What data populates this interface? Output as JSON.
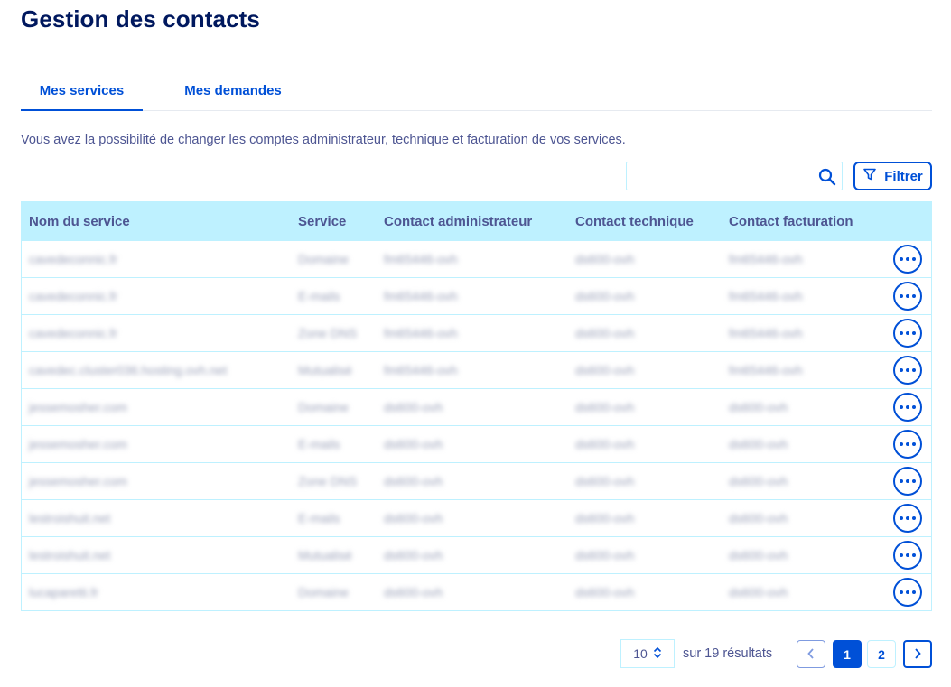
{
  "page": {
    "title": "Gestion des contacts",
    "intro": "Vous avez la possibilité de changer les comptes administrateur, technique et facturation de vos services."
  },
  "tabs": [
    {
      "label": "Mes services",
      "active": true
    },
    {
      "label": "Mes demandes",
      "active": false
    }
  ],
  "toolbar": {
    "search_placeholder": "",
    "filter_label": "Filtrer"
  },
  "table": {
    "headers": [
      "Nom du service",
      "Service",
      "Contact administrateur",
      "Contact technique",
      "Contact facturation"
    ],
    "rows": [
      [
        "cavedeconnic.fr",
        "Domaine",
        "fm65446-ovh",
        "ds600-ovh",
        "fm65446-ovh"
      ],
      [
        "cavedeconnic.fr",
        "E-mails",
        "fm65446-ovh",
        "ds600-ovh",
        "fm65446-ovh"
      ],
      [
        "cavedeconnic.fr",
        "Zone DNS",
        "fm65446-ovh",
        "ds600-ovh",
        "fm65446-ovh"
      ],
      [
        "cavedec.cluster036.hosting.ovh.net",
        "Mutualisé",
        "fm65446-ovh",
        "ds600-ovh",
        "fm65446-ovh"
      ],
      [
        "jessemosher.com",
        "Domaine",
        "ds600-ovh",
        "ds600-ovh",
        "ds600-ovh"
      ],
      [
        "jessemosher.com",
        "E-mails",
        "ds600-ovh",
        "ds600-ovh",
        "ds600-ovh"
      ],
      [
        "jessemosher.com",
        "Zone DNS",
        "ds600-ovh",
        "ds600-ovh",
        "ds600-ovh"
      ],
      [
        "lestroishuit.net",
        "E-mails",
        "ds600-ovh",
        "ds600-ovh",
        "ds600-ovh"
      ],
      [
        "lestroishuit.net",
        "Mutualisé",
        "ds600-ovh",
        "ds600-ovh",
        "ds600-ovh"
      ],
      [
        "lucaparetti.fr",
        "Domaine",
        "ds600-ovh",
        "ds600-ovh",
        "ds600-ovh"
      ]
    ]
  },
  "pagination": {
    "per_page": "10",
    "results_text": "sur 19 résultats",
    "pages": [
      "1",
      "2"
    ],
    "current_page": "1"
  },
  "icons": {
    "search": "search-icon",
    "filter": "filter-icon",
    "more": "more-options-icon",
    "prev": "chevron-left-icon",
    "next": "chevron-right-icon",
    "sort": "sort-arrows-icon"
  },
  "colors": {
    "primary": "#0050d7",
    "title": "#00185e",
    "text": "#4d5592",
    "table_header_bg": "#bef1ff"
  }
}
